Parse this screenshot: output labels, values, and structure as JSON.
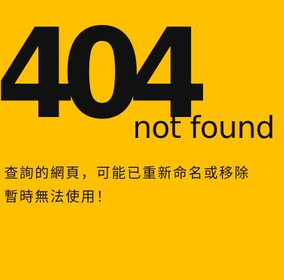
{
  "error": {
    "code": "404",
    "subtitle": "not found",
    "message_line_1": "查詢的網頁，可能已重新命名或移除",
    "message_line_2": "暫時無法使用！"
  },
  "colors": {
    "background": "#FFC000",
    "text": "#111111"
  }
}
